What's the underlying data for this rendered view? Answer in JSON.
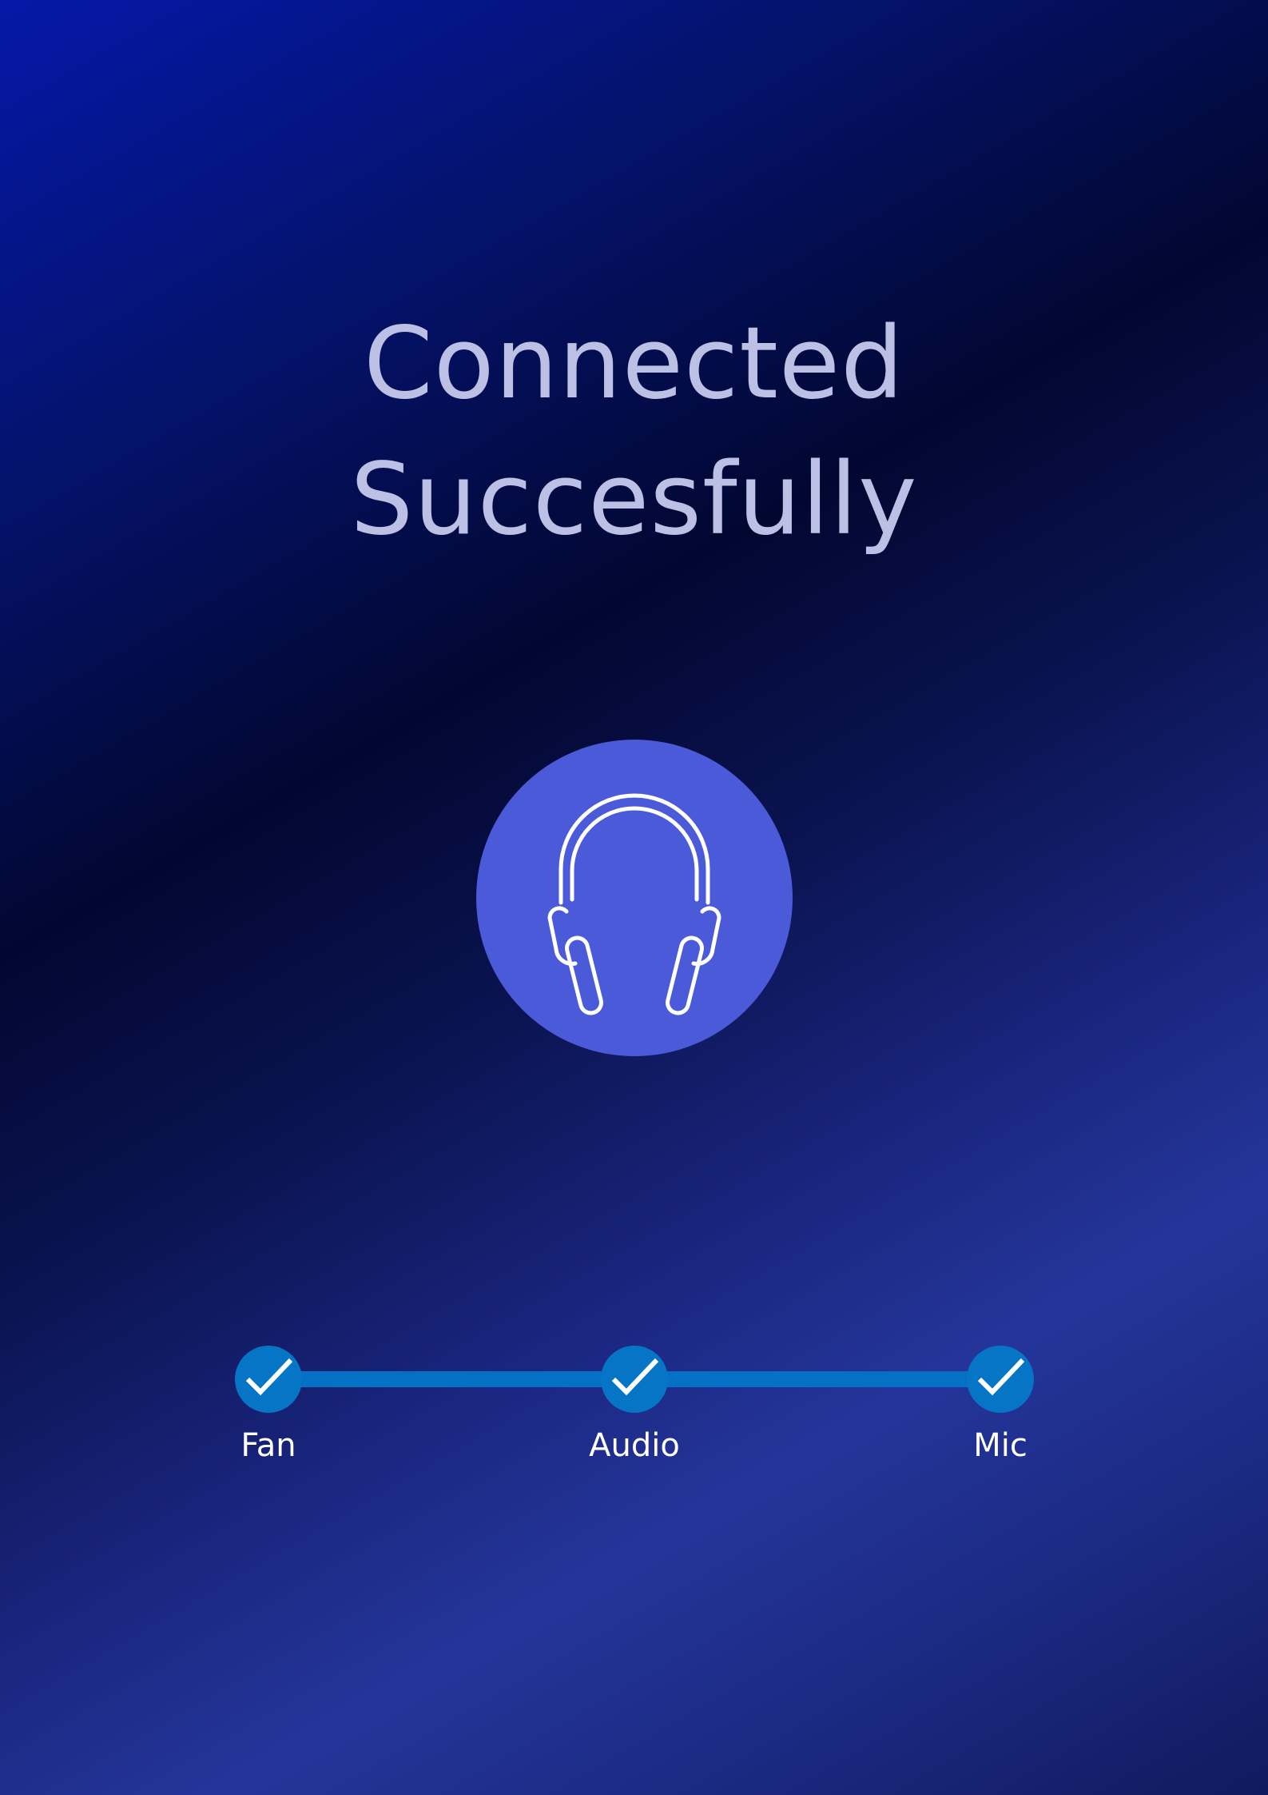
{
  "status": {
    "title_line1": "Connected",
    "title_line2": "Succesfully",
    "icon": "headphones-icon"
  },
  "steps": [
    {
      "label": "Fan",
      "state": "complete",
      "icon": "checkmark-icon"
    },
    {
      "label": "Audio",
      "state": "complete",
      "icon": "checkmark-icon"
    },
    {
      "label": "Mic",
      "state": "complete",
      "icon": "checkmark-icon"
    }
  ],
  "colors": {
    "background_start": "#0518a8",
    "background_mid": "#020731",
    "background_end": "#24359a",
    "title": "#bcc0e4",
    "icon_circle": "#4b5ad9",
    "step_accent": "#0675c6",
    "label": "#ffffff"
  }
}
